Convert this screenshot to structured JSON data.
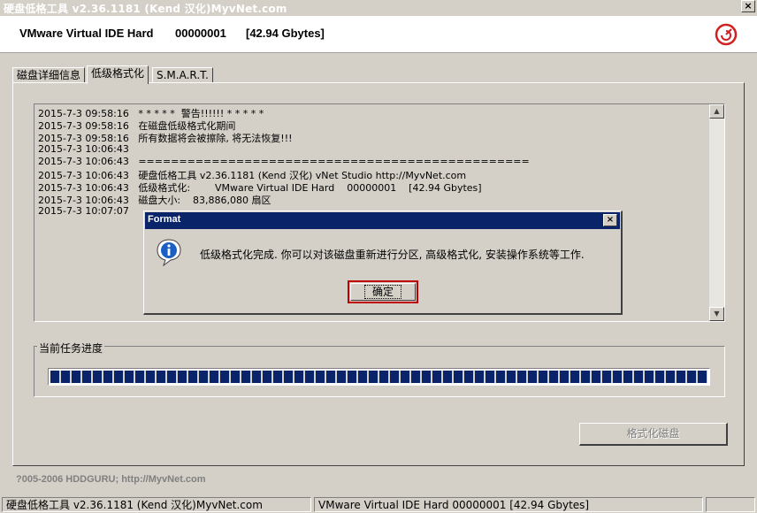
{
  "window": {
    "title": "硬盘低格工具 v2.36.1181 (Kend 汉化)MyvNet.com",
    "close": "×"
  },
  "header": {
    "model": "VMware Virtual IDE Hard",
    "serial": "00000001",
    "size": "[42.94 Gbytes]",
    "logo_icon": "hddguru-logo-icon"
  },
  "tabs": [
    {
      "label": "磁盘详细信息",
      "active": false
    },
    {
      "label": "低级格式化",
      "active": true
    },
    {
      "label": "S.M.A.R.T.",
      "active": false
    }
  ],
  "log": {
    "lines": [
      "2015-7-3 09:58:16   * * * * *  警告!!!!!! * * * * *",
      "2015-7-3 09:58:16   在磁盘低级格式化期间",
      "2015-7-3 09:58:16   所有数据将会被擦除, 将无法恢复!!!",
      "2015-7-3 10:06:43",
      "2015-7-3 10:06:43   ================================================",
      "2015-7-3 10:06:43   硬盘低格工具 v2.36.1181 (Kend 汉化) vNet Studio http://MyvNet.com",
      "2015-7-3 10:06:43   低级格式化:        VMware Virtual IDE Hard    00000001    [42.94 Gbytes]",
      "2015-7-3 10:06:43   磁盘大小:    83,886,080 扇区",
      "2015-7-3 10:07:07"
    ],
    "scroll_up": "▲",
    "scroll_down": "▼"
  },
  "progress": {
    "label": "当前任务进度",
    "percent": 100
  },
  "format_button": "格式化磁盘",
  "copyright": "?005-2006 HDDGURU;   http://MyvNet.com",
  "statusbar": {
    "left": "硬盘低格工具 v2.36.1181 (Kend 汉化)MyvNet.com",
    "right": "VMware Virtual IDE Hard    00000001    [42.94 Gbytes]"
  },
  "dialog": {
    "title": "Format",
    "close": "×",
    "icon": "info-icon",
    "message": "低级格式化完成. 你可以对该磁盘重新进行分区, 高级格式化, 安装操作系统等工作.",
    "ok_label": "确定"
  }
}
